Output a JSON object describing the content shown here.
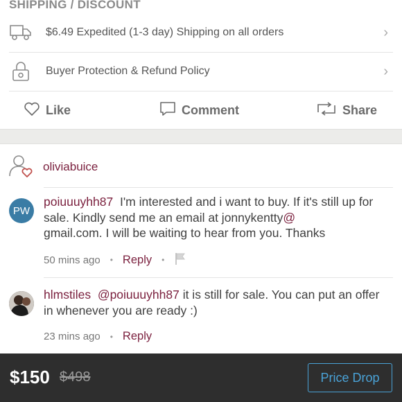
{
  "section_header": "SHIPPING / DISCOUNT",
  "shipping": {
    "label": "$6.49 Expedited (1-3 day) Shipping on all orders",
    "icon": "truck-icon"
  },
  "protection": {
    "label": "Buyer Protection & Refund Policy",
    "icon": "lock-icon"
  },
  "actions": {
    "like": "Like",
    "comment": "Comment",
    "share": "Share"
  },
  "owner": {
    "username": "oliviabuice",
    "icon": "user-heart-icon"
  },
  "comments": [
    {
      "avatar_initials": "PW",
      "avatar_color": "#3a7ca5",
      "username": "poiuuuyhh87",
      "text": "I'm interested and i want to buy. If it's still up for sale. Kindly send me an email at jonnykentty",
      "at_symbol": "@",
      "text_tail": "gmail.com. I will be waiting to hear from you. Thanks",
      "time": "50 mins ago",
      "reply": "Reply"
    },
    {
      "username": "hlmstiles",
      "mention": "@poiuuuyhh87",
      "text": "it is still for sale. You can put an offer in whenever you are ready :)",
      "time": "23 mins ago",
      "reply": "Reply"
    }
  ],
  "bottom": {
    "price": "$150",
    "original_price": "$498",
    "price_drop_label": "Price Drop",
    "accent": "#4aa3d8"
  },
  "colors": {
    "username": "#7a1f3d",
    "band": "#ececea",
    "bottom_bar": "#2e2e2e"
  }
}
